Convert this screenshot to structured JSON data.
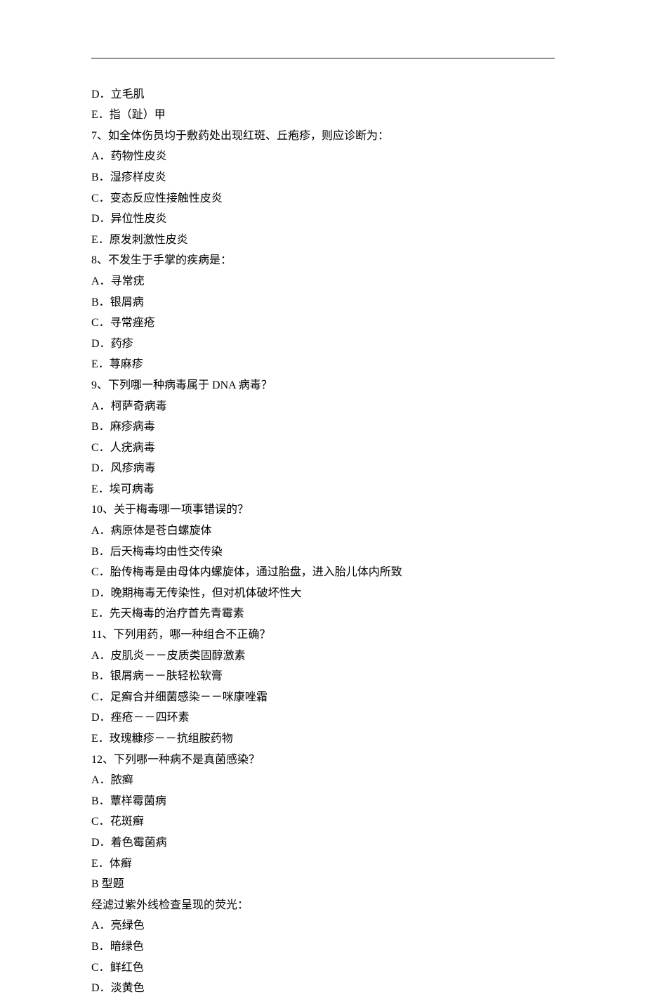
{
  "hr": "———————————————————————————————————————————————————",
  "lines": [
    {
      "pre": "D．",
      "text": "立毛肌"
    },
    {
      "pre": "E．",
      "text": "指（趾）甲"
    },
    {
      "pre": "7、",
      "text": "如全体伤员均于敷药处出现红斑、丘疱疹，则应诊断为："
    },
    {
      "pre": "A．",
      "text": "药物性皮炎"
    },
    {
      "pre": "B．",
      "text": "湿疹样皮炎"
    },
    {
      "pre": "C．",
      "text": "变态反应性接触性皮炎"
    },
    {
      "pre": "D．",
      "text": "异位性皮炎"
    },
    {
      "pre": "E．",
      "text": "原发刺激性皮炎"
    },
    {
      "pre": "8、",
      "text": "不发生于手掌的疾病是："
    },
    {
      "pre": "A．",
      "text": "寻常疣"
    },
    {
      "pre": "B．",
      "text": "银屑病"
    },
    {
      "pre": "C．",
      "text": "寻常痤疮"
    },
    {
      "pre": "D．",
      "text": "药疹"
    },
    {
      "pre": "E．",
      "text": "荨麻疹"
    },
    {
      "pre": "9、",
      "text": "下列哪一种病毒属于 DNA 病毒？"
    },
    {
      "pre": "A．",
      "text": "柯萨奇病毒"
    },
    {
      "pre": "B．",
      "text": "麻疹病毒"
    },
    {
      "pre": "C．",
      "text": "人疣病毒"
    },
    {
      "pre": "D．",
      "text": "风疹病毒"
    },
    {
      "pre": "E．",
      "text": "埃可病毒"
    },
    {
      "pre": "10、",
      "text": "关于梅毒哪一项事错误的？"
    },
    {
      "pre": "A．",
      "text": "病原体是苍白螺旋体"
    },
    {
      "pre": "B．",
      "text": "后天梅毒均由性交传染"
    },
    {
      "pre": "C．",
      "text": "胎传梅毒是由母体内螺旋体，通过胎盘，进入胎儿体内所致"
    },
    {
      "pre": "D．",
      "text": "晚期梅毒无传染性，但对机体破坏性大"
    },
    {
      "pre": "E．",
      "text": "先天梅毒的治疗首先青霉素"
    },
    {
      "pre": "11、",
      "text": "下列用药，哪一种组合不正确？"
    },
    {
      "pre": "A．",
      "text": "皮肌炎－－皮质类固醇激素"
    },
    {
      "pre": "B．",
      "text": "银屑病－－肤轻松软膏"
    },
    {
      "pre": "C．",
      "text": "足癣合并细菌感染－－咪康唑霜"
    },
    {
      "pre": "D．",
      "text": "痤疮－－四环素"
    },
    {
      "pre": "E．",
      "text": "玫瑰糠疹－－抗组胺药物"
    },
    {
      "pre": "12、",
      "text": "下列哪一种病不是真菌感染？"
    },
    {
      "pre": "A．",
      "text": "脓癣"
    },
    {
      "pre": "B．",
      "text": "蕈样霉菌病"
    },
    {
      "pre": "C．",
      "text": "花斑癣"
    },
    {
      "pre": "D．",
      "text": "着色霉菌病"
    },
    {
      "pre": "E．",
      "text": "体癣"
    },
    {
      "pre": "",
      "text": "B 型题"
    },
    {
      "pre": "",
      "text": "经滤过紫外线检查呈现的荧光："
    },
    {
      "pre": "A．",
      "text": "亮绿色"
    },
    {
      "pre": "B．",
      "text": "暗绿色"
    },
    {
      "pre": "C．",
      "text": "鲜红色"
    },
    {
      "pre": "D．",
      "text": "淡黄色"
    }
  ]
}
